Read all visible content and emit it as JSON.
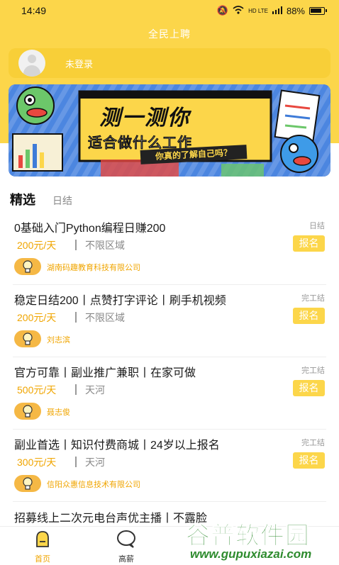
{
  "status_bar": {
    "time": "14:49",
    "network": "HD LTE",
    "battery": "88%"
  },
  "header": {
    "title": "全民上聘"
  },
  "login": {
    "text": "未登录"
  },
  "banner": {
    "title": "测一测你",
    "subtitle": "适合做什么工作",
    "tag": "你真的了解自己吗？"
  },
  "tabs": [
    {
      "label": "精选"
    },
    {
      "label": "日结"
    }
  ],
  "jobs": [
    {
      "title": "0基础入门Python编程日赚200",
      "type": "日结",
      "salary": "200元/天",
      "area": "不限区域",
      "apply": "报名",
      "company": "湖南码趣教育科技有限公司"
    },
    {
      "title": "稳定日结200丨点赞打字评论丨刷手机视频",
      "type": "完工结",
      "salary": "200元/天",
      "area": "不限区域",
      "apply": "报名",
      "company": "刘志滨"
    },
    {
      "title": "官方可靠丨副业推广兼职丨在家可做",
      "type": "完工结",
      "salary": "500元/天",
      "area": "天河",
      "apply": "报名",
      "company": "聂志俊"
    },
    {
      "title": "副业首选丨知识付费商城丨24岁以上报名",
      "type": "完工结",
      "salary": "300元/天",
      "area": "天河",
      "apply": "报名",
      "company": "信阳众惠信息技术有限公司"
    }
  ],
  "partial_job": {
    "title": "招募线上二次元电台声优主播丨不露脸"
  },
  "bottom_nav": [
    {
      "label": "首页",
      "icon": "home-icon"
    },
    {
      "label": "高薪",
      "icon": "chat-bubble-icon"
    }
  ],
  "watermark": {
    "big": "谷普软件园",
    "small": "www.gupuxiazai.com"
  },
  "colors": {
    "brand_yellow": "#fcd64a",
    "salary_orange": "#f0a500",
    "banner_blue": "#3e7bd8"
  }
}
